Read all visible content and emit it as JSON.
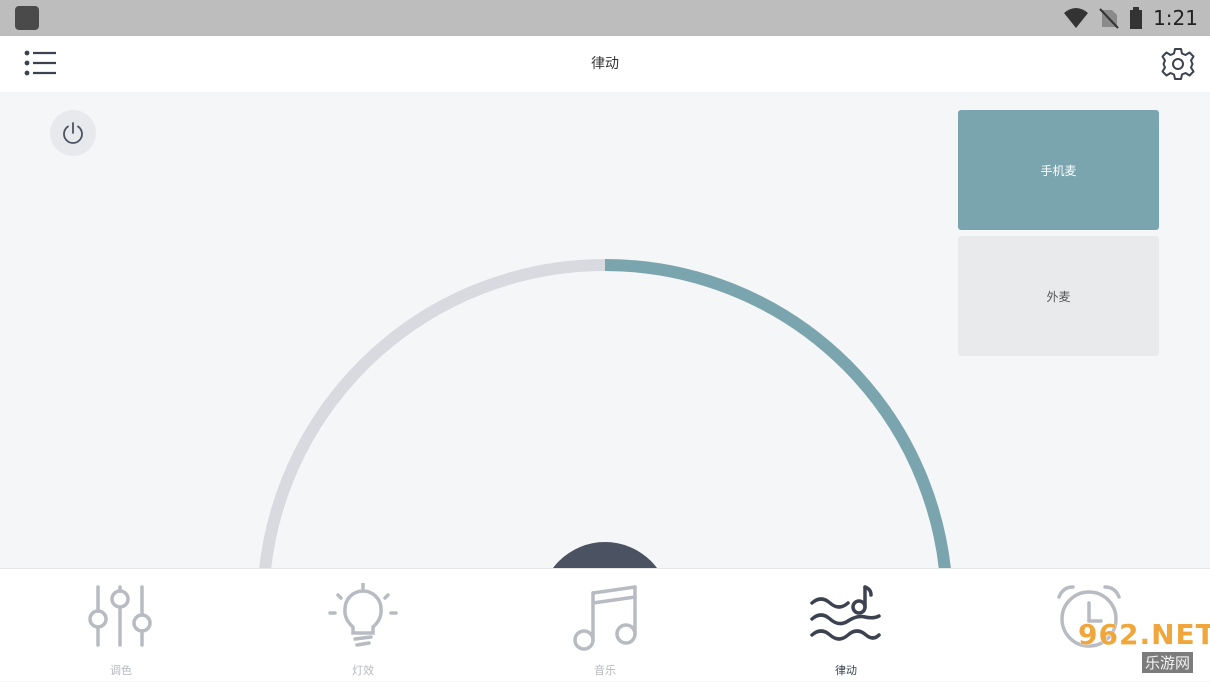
{
  "status_bar": {
    "time": "1:21",
    "icons": [
      "wifi-icon",
      "no-sim-icon",
      "battery-icon"
    ]
  },
  "header": {
    "title": "律动",
    "menu_icon": "list-menu-icon",
    "settings_icon": "gear-icon"
  },
  "power": {
    "icon": "power-icon"
  },
  "mic_options": {
    "phone": "手机麦",
    "external": "外麦",
    "selected": "手机麦"
  },
  "gauge": {
    "level_fraction": 0.5,
    "track_color": "#d9dadf",
    "fill_color": "#7ba5ae",
    "knob_color": "#4b5262"
  },
  "bottom_nav": {
    "items": [
      {
        "label": "调色",
        "icon": "sliders-icon",
        "active": false
      },
      {
        "label": "灯效",
        "icon": "lightbulb-icon",
        "active": false
      },
      {
        "label": "音乐",
        "icon": "music-note-icon",
        "active": false
      },
      {
        "label": "律动",
        "icon": "rhythm-wave-icon",
        "active": true
      },
      {
        "label": "",
        "icon": "alarm-clock-icon",
        "active": false
      }
    ]
  },
  "watermark": {
    "main": "962.NET",
    "sub": "乐游网"
  },
  "colors": {
    "accent": "#7ba5ae",
    "active_icon": "#3c4250",
    "inactive_icon": "#b8bbc2"
  }
}
